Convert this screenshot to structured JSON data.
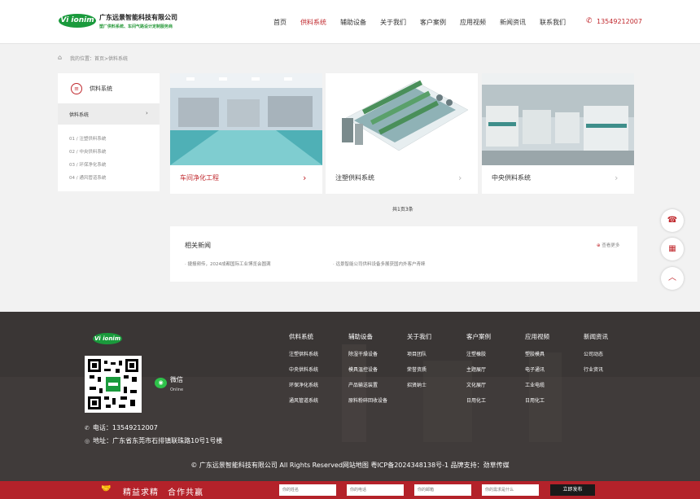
{
  "header": {
    "logo_badge": "Vi ionim",
    "company": "广东远景智能科技有限公司",
    "slogan": "塑厂供料系统、车间气路设计定制服务商",
    "nav": [
      "首页",
      "供料系统",
      "辅助设备",
      "关于我们",
      "客户案例",
      "应用视频",
      "新闻资讯",
      "联系我们"
    ],
    "active_nav": "供料系统",
    "phone": "13549212007"
  },
  "breadcrumb": "我的位置：首页>供料系统",
  "sidebar": {
    "title": "供料系统",
    "active": "供料系统",
    "items": [
      "01 / 注塑供料系统",
      "02 / 中央供料系统",
      "03 / 环保净化系统",
      "04 / 通风管道系统"
    ]
  },
  "products": [
    {
      "title": "车间净化工程"
    },
    {
      "title": "注塑供料系统"
    },
    {
      "title": "中央供料系统"
    }
  ],
  "pager": "共1页3条",
  "news": {
    "title": "相关新闻",
    "more": "查看更多",
    "items": [
      "· 捷报频传，2024成都国际工业博览会圆满",
      "· 远景智能公司供料设备多展获国内外客户青睐"
    ]
  },
  "footer": {
    "logo": "Vi ionim",
    "wechat_label": "微信",
    "wechat_sub": "Online",
    "phone": "电话：13549212007",
    "address": "地址：广东省东莞市石排镇联珠路10号1号楼",
    "columns": [
      {
        "head": "供料系统",
        "items": [
          "注塑供料系统",
          "中央供料系统",
          "环保净化系统",
          "通风管道系统"
        ]
      },
      {
        "head": "辅助设备",
        "items": [
          "除湿干燥设备",
          "模具温控设备",
          "产品输送装置",
          "原料粉碎回收设备"
        ]
      },
      {
        "head": "关于我们",
        "items": [
          "项目团队",
          "荣誉资质",
          "招贤纳士"
        ]
      },
      {
        "head": "客户案例",
        "items": [
          "注塑橡胶",
          "主题展厅",
          "文化展厅",
          "日用化工"
        ]
      },
      {
        "head": "应用视频",
        "items": [
          "塑胶模具",
          "电子通讯",
          "工业电缆",
          "日用化工"
        ]
      },
      {
        "head": "新闻资讯",
        "items": [
          "公司动态",
          "行业资讯"
        ]
      }
    ],
    "copyright": "© 广东远景智能科技有限公司 All Rights Reserved网站地图 粤ICP备2024348138号-1 品牌支持：劲草传媒"
  },
  "bottom_bar": {
    "slogan": "精益求精　合作共赢",
    "placeholders": [
      "你的姓名",
      "你的电话",
      "你的邮箱",
      "你的需求是什么"
    ],
    "submit": "立即发布"
  },
  "colors": {
    "accent": "#c0282d",
    "brand_green": "#1a9a3c",
    "footer_bg": "#3a3635",
    "bottom_bar": "#b4222a"
  }
}
